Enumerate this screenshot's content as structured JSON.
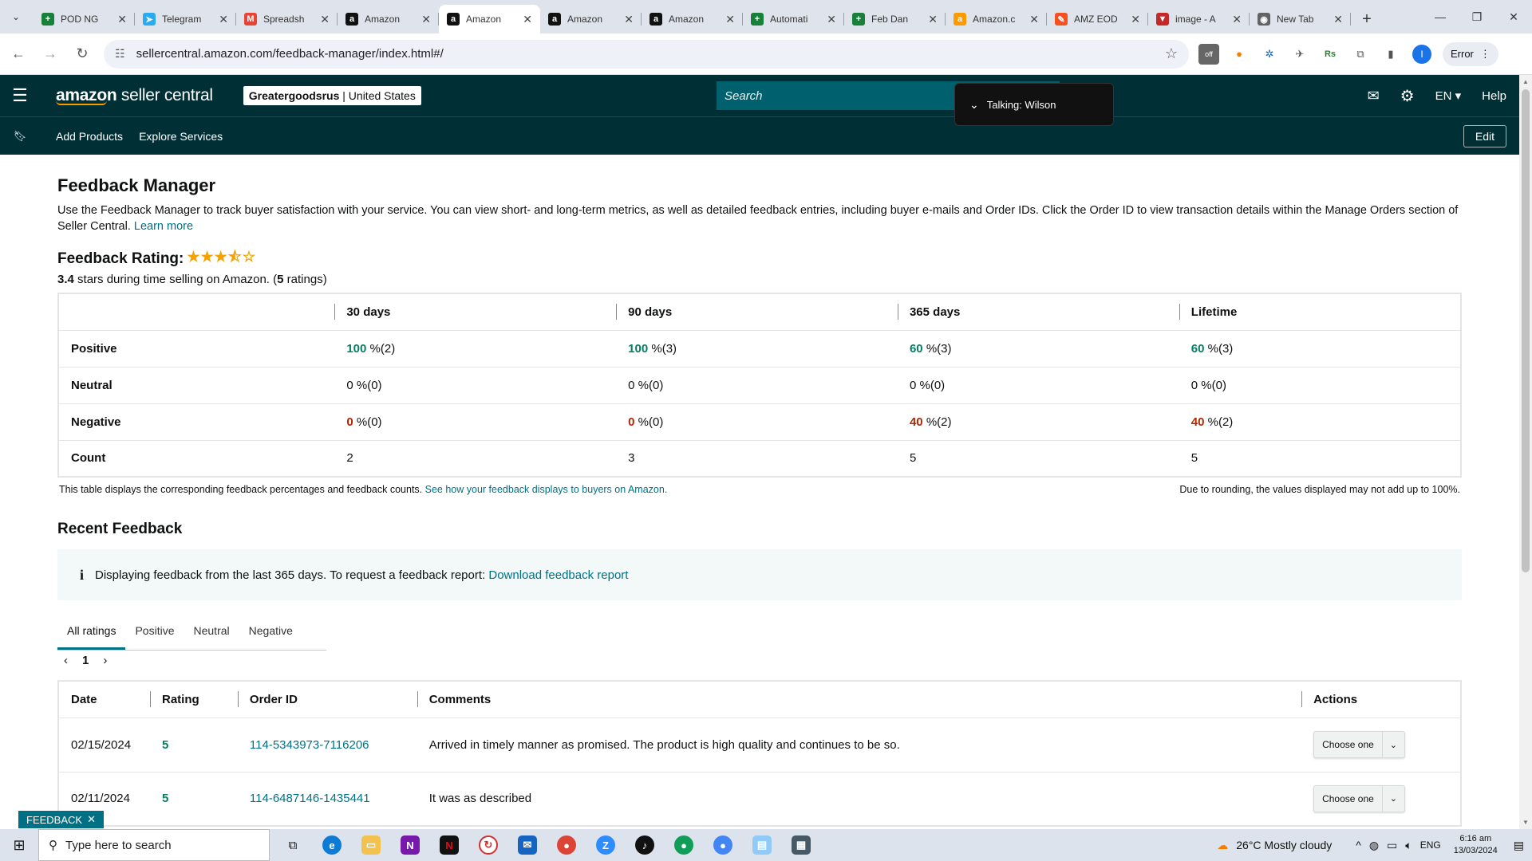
{
  "browser": {
    "tabs": [
      {
        "title": "POD NG",
        "fav": "+",
        "color": "#188038"
      },
      {
        "title": "Telegram",
        "fav": "➤",
        "color": "#2aabee"
      },
      {
        "title": "Spreadsh",
        "fav": "M",
        "color": "#ea4335"
      },
      {
        "title": "Amazon",
        "fav": "a",
        "color": "#111"
      },
      {
        "title": "Amazon",
        "fav": "a",
        "color": "#111",
        "active": true
      },
      {
        "title": "Amazon",
        "fav": "a",
        "color": "#111"
      },
      {
        "title": "Amazon",
        "fav": "a",
        "color": "#111"
      },
      {
        "title": "Automati",
        "fav": "+",
        "color": "#188038"
      },
      {
        "title": "Feb Dan",
        "fav": "+",
        "color": "#188038"
      },
      {
        "title": "Amazon.c",
        "fav": "a",
        "color": "#ff9900"
      },
      {
        "title": "AMZ EOD",
        "fav": "✎",
        "color": "#f4511e"
      },
      {
        "title": "image - A",
        "fav": "▼",
        "color": "#c62828"
      },
      {
        "title": "New Tab",
        "fav": "◉",
        "color": "#5f6368"
      }
    ],
    "url": "sellercentral.amazon.com/feedback-manager/index.html#/",
    "error_label": "Error",
    "profile_initial": "I"
  },
  "header": {
    "logo_brand": "amazon",
    "logo_suffix": " seller central",
    "merchant_name": "Greatergoodsrus",
    "merchant_sep": " | ",
    "merchant_region": "United States",
    "search_placeholder": "Search",
    "language": "EN",
    "help": "Help",
    "talking": "Talking: Wilson"
  },
  "subnav": {
    "add_products": "Add Products",
    "explore_services": "Explore Services",
    "edit": "Edit"
  },
  "page": {
    "title": "Feedback Manager",
    "intro": "Use the Feedback Manager to track buyer satisfaction with your service. You can view short- and long-term metrics, as well as detailed feedback entries, including buyer e-mails and Order IDs. Click the Order ID to view transaction details within the Manage Orders section of Seller Central.",
    "learn_more": "Learn more",
    "rating_label": "Feedback Rating:",
    "rating_value": 3.4,
    "rating_stars_text": "3.4",
    "rating_sub_mid": " stars during time selling on Amazon. (",
    "rating_count": "5",
    "rating_sub_end": " ratings)"
  },
  "metrics": {
    "columns": [
      "30 days",
      "90 days",
      "365 days",
      "Lifetime"
    ],
    "rows": [
      {
        "label": "Positive",
        "cells": [
          {
            "v": "100",
            "s": " %(2)"
          },
          {
            "v": "100",
            "s": " %(3)"
          },
          {
            "v": "60",
            "s": " %(3)"
          },
          {
            "v": "60",
            "s": " %(3)"
          }
        ]
      },
      {
        "label": "Neutral",
        "cells": [
          {
            "v": "0",
            "s": " %(0)"
          },
          {
            "v": "0",
            "s": " %(0)"
          },
          {
            "v": "0",
            "s": " %(0)"
          },
          {
            "v": "0",
            "s": " %(0)"
          }
        ]
      },
      {
        "label": "Negative",
        "cells": [
          {
            "v": "0",
            "s": " %(0)"
          },
          {
            "v": "0",
            "s": " %(0)"
          },
          {
            "v": "40",
            "s": " %(2)"
          },
          {
            "v": "40",
            "s": " %(2)"
          }
        ]
      },
      {
        "label": "Count",
        "cells": [
          {
            "v": "2",
            "s": ""
          },
          {
            "v": "3",
            "s": ""
          },
          {
            "v": "5",
            "s": ""
          },
          {
            "v": "5",
            "s": ""
          }
        ]
      }
    ],
    "note_left": "This table displays the corresponding feedback percentages and feedback counts.",
    "note_link": "See how your feedback displays to buyers on Amazon.",
    "note_right": "Due to rounding, the values displayed may not add up to 100%."
  },
  "recent": {
    "title": "Recent Feedback",
    "info_text": "Displaying feedback from the last 365 days. To request a feedback report:",
    "info_link": "Download feedback report",
    "tabs": [
      "All ratings",
      "Positive",
      "Neutral",
      "Negative"
    ],
    "page": "1",
    "columns": [
      "Date",
      "Rating",
      "Order ID",
      "Comments",
      "Actions"
    ],
    "rows": [
      {
        "date": "02/15/2024",
        "rating": "5",
        "order": "114-5343973-7116206",
        "comment": "Arrived in timely manner as promised. The product is high quality and continues to be so.",
        "action": "Choose one"
      },
      {
        "date": "02/11/2024",
        "rating": "5",
        "order": "114-6487146-1435441",
        "comment": "It was as described",
        "action": "Choose one"
      }
    ],
    "feedback_tag": "FEEDBACK"
  },
  "taskbar": {
    "search_placeholder": "Type here to search",
    "weather": "26°C  Mostly cloudy",
    "lang": "ENG",
    "time": "6:16 am",
    "date": "13/03/2024"
  }
}
